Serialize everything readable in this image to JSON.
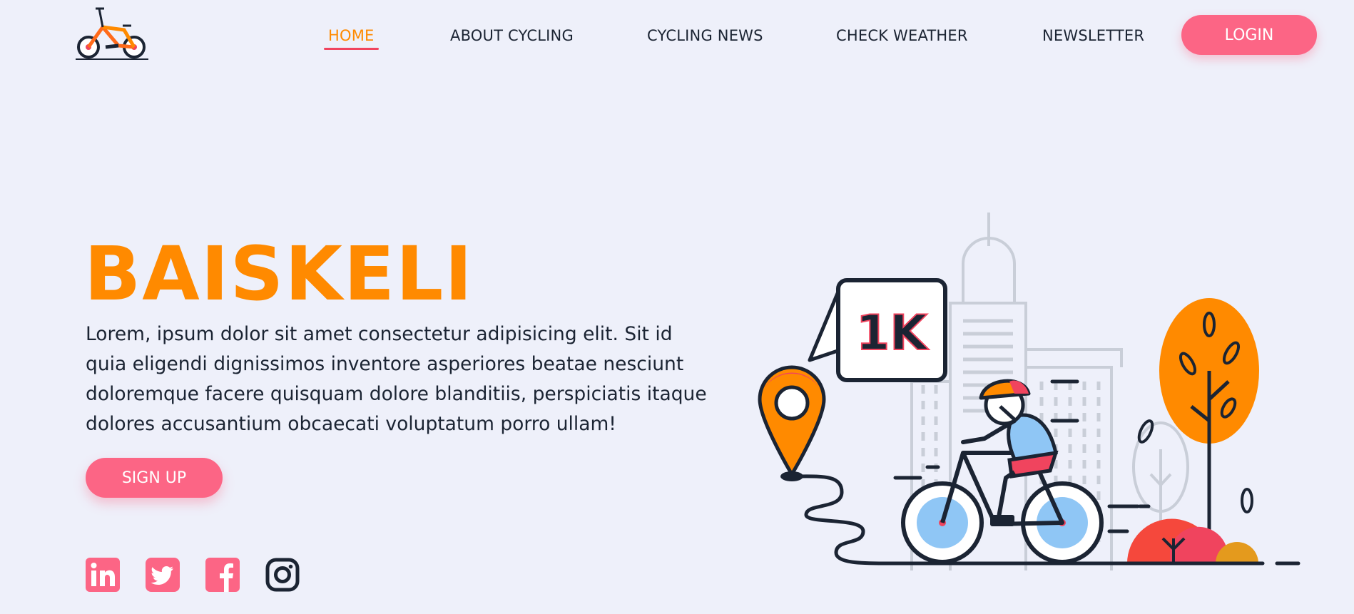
{
  "nav": {
    "links": [
      {
        "label": "HOME",
        "active": true
      },
      {
        "label": "ABOUT CYCLING",
        "active": false
      },
      {
        "label": "CYCLING NEWS",
        "active": false
      },
      {
        "label": "CHECK WEATHER",
        "active": false
      },
      {
        "label": "NEWSLETTER",
        "active": false
      }
    ],
    "login_label": "LOGIN"
  },
  "hero": {
    "title": "BAISKELI",
    "description": "Lorem, ipsum dolor sit amet consectetur adipisicing elit. Sit id quia eligendi dignissimos inventore asperiores beatae nesciunt doloremque facere quisquam dolore blanditiis, perspiciatis itaque dolores accusantium obcaecati voluptatum porro ullam!",
    "signup_label": "SIGN UP"
  },
  "illustration": {
    "badge_text": "1K"
  },
  "social": [
    {
      "icon": "linkedin-icon"
    },
    {
      "icon": "twitter-icon"
    },
    {
      "icon": "facebook-icon"
    },
    {
      "icon": "instagram-icon"
    }
  ],
  "colors": {
    "accent_orange": "#ff8a00",
    "accent_pink": "#fc6585",
    "background": "#eef0fa",
    "text_dark": "#1b2433"
  }
}
